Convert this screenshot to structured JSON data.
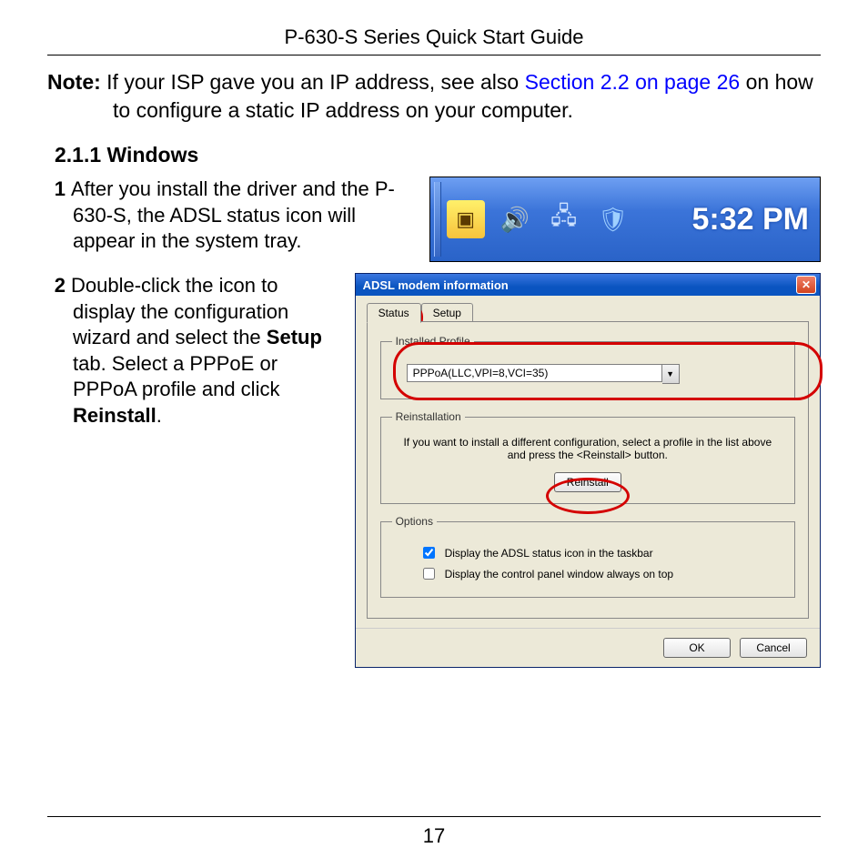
{
  "header": {
    "title": "P-630-S Series Quick Start Guide"
  },
  "note": {
    "label": "Note:",
    "before": " If your ISP gave you an IP address, see also ",
    "xref": "Section 2.2 on page 26",
    "after": " on how to configure a static IP address on your computer."
  },
  "section": {
    "number": "2.1.1",
    "title": "Windows"
  },
  "steps": {
    "s1": {
      "num": "1",
      "text": "After you install the driver and the P-630-S, the ADSL status icon will appear in the system tray."
    },
    "s2": {
      "num": "2",
      "t_a": "Double-click the icon to display the configuration wizard and select the ",
      "t_b": "Setup",
      "t_c": " tab. Select a PPPoE or PPPoA profile and click ",
      "t_d": "Reinstall",
      "t_e": "."
    }
  },
  "tray": {
    "icons": {
      "adsl": "adsl-status-icon",
      "vol": "🔊",
      "net": "🖧",
      "av": "🛡"
    },
    "clock": "5:32 PM"
  },
  "dialog": {
    "title": "ADSL modem information",
    "close": "✕",
    "tabs": {
      "status": "Status",
      "setup": "Setup"
    },
    "profile": {
      "legend": "Installed Profile",
      "value": "PPPoA(LLC,VPI=8,VCI=35)",
      "drop": "▼"
    },
    "reinstall": {
      "legend": "Reinstallation",
      "text": "If you want to install a different configuration, select a profile in the list above and press the <Reinstall> button.",
      "button": "Reinstall"
    },
    "options": {
      "legend": "Options",
      "opt1": {
        "label": "Display the ADSL status icon in the taskbar",
        "checked": true
      },
      "opt2": {
        "label": "Display the control panel window always on top",
        "checked": false
      }
    },
    "footer": {
      "ok": "OK",
      "cancel": "Cancel"
    }
  },
  "page_number": "17"
}
